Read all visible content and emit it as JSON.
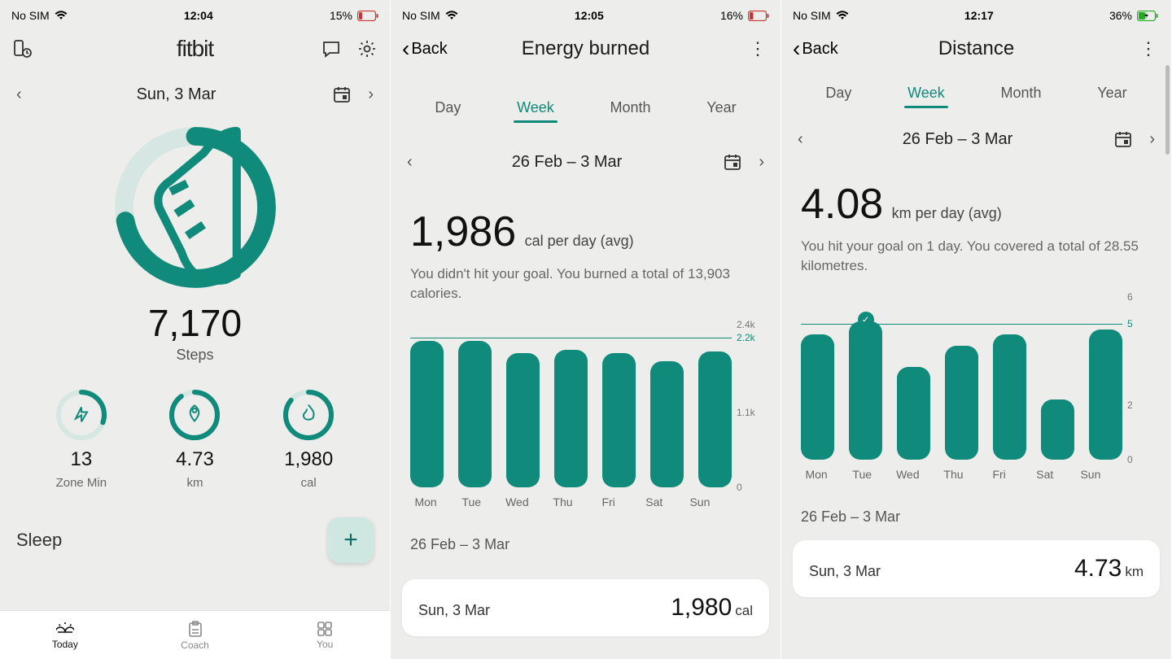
{
  "colors": {
    "accent": "#108a7a"
  },
  "p1": {
    "status": {
      "sim": "No SIM",
      "time": "12:04",
      "battery": "15%"
    },
    "brand": "fitbit",
    "date": "Sun, 3 Mar",
    "steps_value": "7,170",
    "steps_label": "Steps",
    "mini": [
      {
        "value": "13",
        "label": "Zone Min"
      },
      {
        "value": "4.73",
        "label": "km"
      },
      {
        "value": "1,980",
        "label": "cal"
      }
    ],
    "sleep_section": "Sleep",
    "tabbar": [
      "Today",
      "Coach",
      "You"
    ]
  },
  "p2": {
    "status": {
      "sim": "No SIM",
      "time": "12:05",
      "battery": "16%"
    },
    "back": "Back",
    "title": "Energy burned",
    "tabs": [
      "Day",
      "Week",
      "Month",
      "Year"
    ],
    "active_tab": "Week",
    "daterange": "26 Feb – 3 Mar",
    "value": "1,986",
    "unit": "cal per day (avg)",
    "subtitle": "You didn't hit your goal. You burned a total of 13,903 calories.",
    "list_header": "26 Feb – 3 Mar",
    "card": {
      "date": "Sun, 3 Mar",
      "value": "1,980",
      "unit": "cal"
    }
  },
  "p3": {
    "status": {
      "sim": "No SIM",
      "time": "12:17",
      "battery": "36%"
    },
    "back": "Back",
    "title": "Distance",
    "tabs": [
      "Day",
      "Week",
      "Month",
      "Year"
    ],
    "active_tab": "Week",
    "daterange": "26 Feb – 3 Mar",
    "value": "4.08",
    "unit": "km per day (avg)",
    "subtitle": "You hit your goal on 1 day. You covered a total of 28.55 kilometres.",
    "list_header": "26 Feb – 3 Mar",
    "card": {
      "date": "Sun, 3 Mar",
      "value": "4.73",
      "unit": "km"
    }
  },
  "chart_data": [
    {
      "type": "bar",
      "title": "Energy burned — Week 26 Feb – 3 Mar",
      "categories": [
        "Mon",
        "Tue",
        "Wed",
        "Thu",
        "Fri",
        "Sat",
        "Sun"
      ],
      "values": [
        2150,
        2150,
        1980,
        2020,
        1980,
        1860,
        2000
      ],
      "goal": 2200,
      "ylim": [
        0,
        2400
      ],
      "yticks": [
        0,
        1100,
        2200,
        2400
      ],
      "ytick_labels": [
        "0",
        "1.1k",
        "2.2k",
        "2.4k"
      ],
      "ylabel": "cal"
    },
    {
      "type": "bar",
      "title": "Distance — Week 26 Feb – 3 Mar",
      "categories": [
        "Mon",
        "Tue",
        "Wed",
        "Thu",
        "Fri",
        "Sat",
        "Sun"
      ],
      "values": [
        4.6,
        5.1,
        3.4,
        4.2,
        4.6,
        2.2,
        4.8
      ],
      "goal": 5,
      "goal_hit_days": [
        "Tue"
      ],
      "ylim": [
        0,
        6
      ],
      "yticks": [
        0,
        2,
        5,
        6
      ],
      "ytick_labels": [
        "0",
        "2",
        "5",
        "6"
      ],
      "ylabel": "km"
    }
  ]
}
